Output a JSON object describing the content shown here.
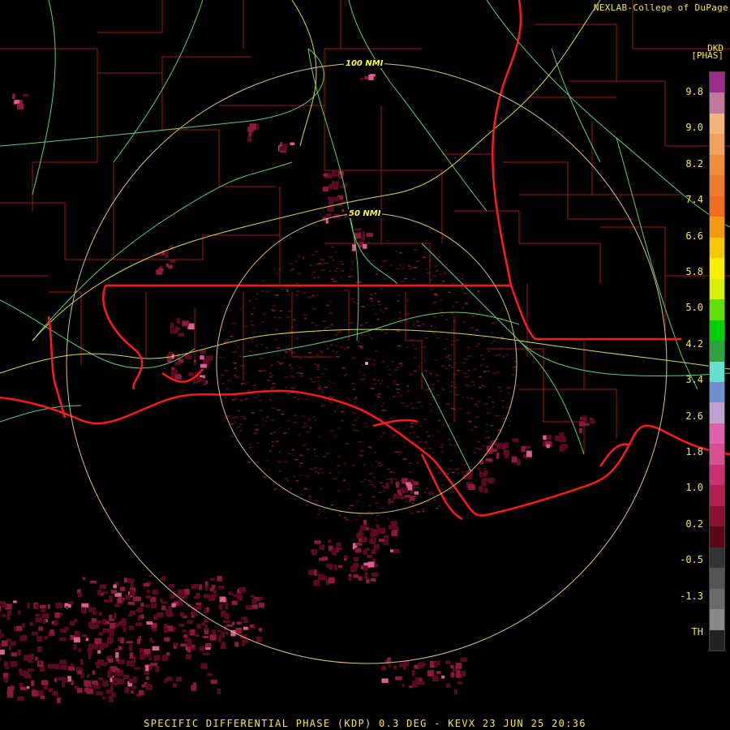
{
  "header": {
    "credit": "NEXLAB-College of DuPage",
    "product_code": "DKD",
    "units": "[PHAS]"
  },
  "footer": {
    "caption": "SPECIFIC DIFFERENTIAL PHASE (KDP) 0.3 DEG - KEVX 23 JUN 25 20:36"
  },
  "range_rings": [
    {
      "label": "100 NMI"
    },
    {
      "label": "50 NMI"
    }
  ],
  "legend": {
    "labels": [
      "9.8",
      "9.0",
      "8.2",
      "7.4",
      "6.6",
      "5.8",
      "5.0",
      "4.2",
      "3.4",
      "2.6",
      "1.8",
      "1.0",
      "0.2",
      "-0.5",
      "-1.3",
      "TH"
    ],
    "colors": [
      "#9a2c8a",
      "#c27a9c",
      "#f3b37a",
      "#f1a060",
      "#ee8f40",
      "#f07a30",
      "#f36a20",
      "#f59a10",
      "#f8c800",
      "#f8ee00",
      "#d8f000",
      "#60e000",
      "#00d000",
      "#30a040",
      "#66e0d0",
      "#7090d0",
      "#c0a0d0",
      "#e060b0",
      "#d85090",
      "#cc3070",
      "#b02050",
      "#8a1030",
      "#5a0818",
      "#333333",
      "#555555",
      "#6a6a6a",
      "#888888",
      "#222222"
    ]
  },
  "map_colors": {
    "background": "#000000",
    "county_lines": "#9a1616",
    "state_lines": "#ff1a1a",
    "coastline": "#ff1a1a",
    "highways": "#5ccf7a",
    "interstates": "#d9d94a",
    "range_rings": "#d9c27a",
    "echo_dark": "#5a0a1e",
    "echo_mid": "#8a1a38",
    "echo_bright": "#d86090"
  }
}
